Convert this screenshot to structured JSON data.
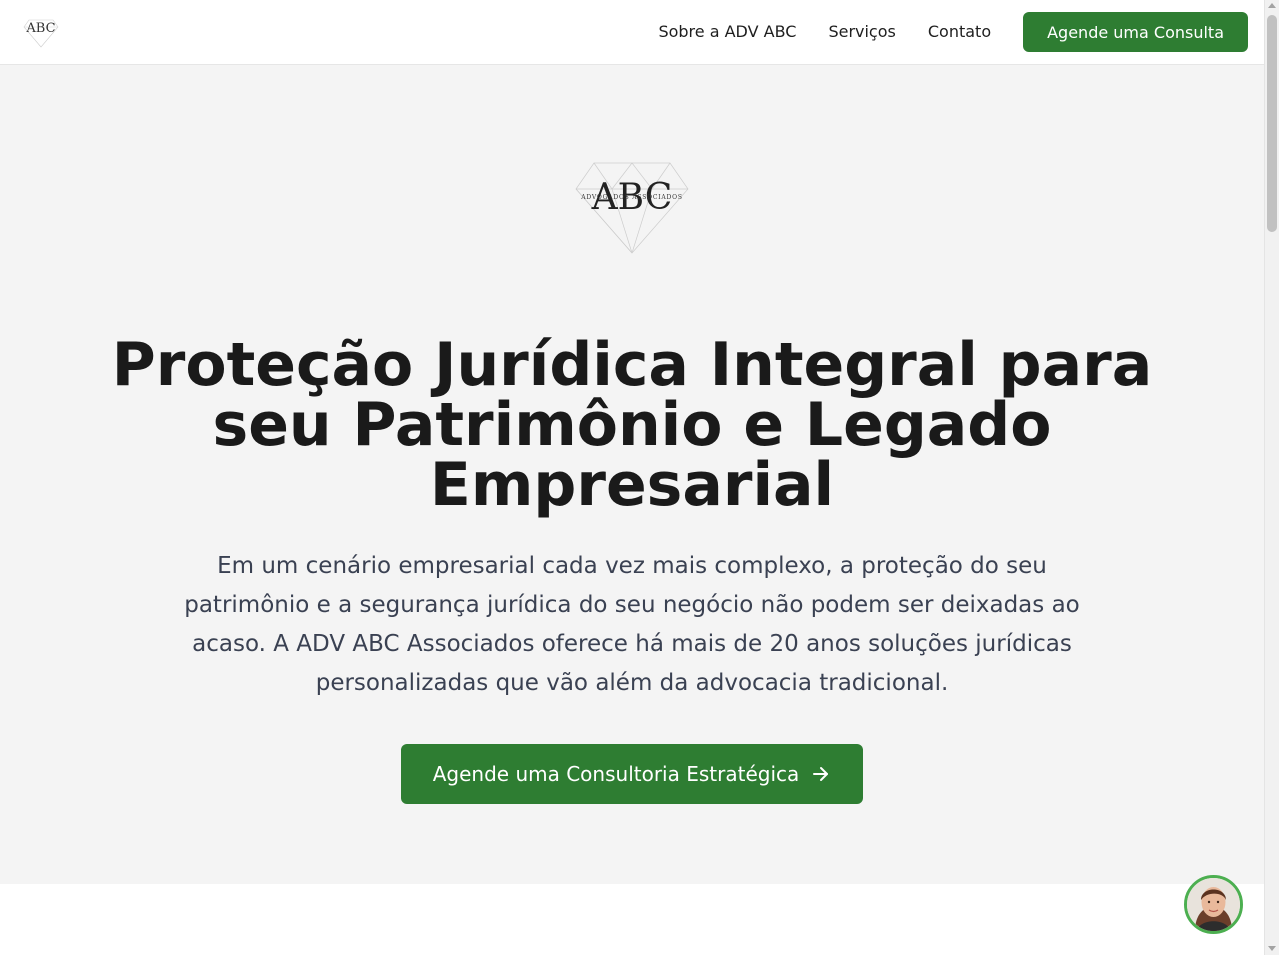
{
  "header": {
    "logo_alt": "ABC",
    "nav": [
      {
        "label": "Sobre a ADV ABC"
      },
      {
        "label": "Serviços"
      },
      {
        "label": "Contato"
      }
    ],
    "cta_label": "Agende uma Consulta"
  },
  "hero": {
    "logo_text": "ABC",
    "logo_subtext": "ADVOGADOS ASSOCIADOS",
    "title": "Proteção Jurídica Integral para seu Patrimônio e Legado Empresarial",
    "text": "Em um cenário empresarial cada vez mais complexo, a proteção do seu patrimônio e a segurança jurídica do seu negócio não podem ser deixadas ao acaso. A ADV ABC Associados oferece há mais de 20 anos soluções jurídicas personalizadas que vão além da advocacia tradicional.",
    "cta_label": "Agende uma Consultoria Estratégica"
  },
  "colors": {
    "primary_green": "#2e7d32",
    "hero_bg": "#f4f4f4",
    "avatar_ring": "#4caf50"
  },
  "icons": {
    "cta_icon": "arrow-right-icon",
    "chat": "chat-avatar-icon"
  }
}
